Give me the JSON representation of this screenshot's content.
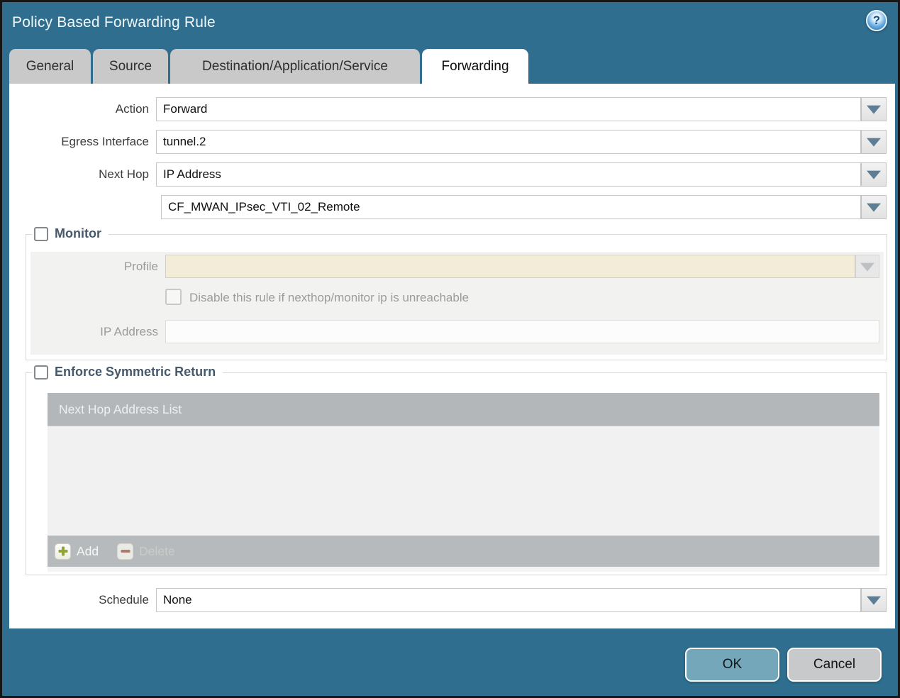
{
  "window": {
    "title": "Policy Based Forwarding Rule"
  },
  "icons": {
    "help": "?"
  },
  "tabs": [
    {
      "label": "General",
      "active": false
    },
    {
      "label": "Source",
      "active": false
    },
    {
      "label": "Destination/Application/Service",
      "active": false
    },
    {
      "label": "Forwarding",
      "active": true
    }
  ],
  "fields": {
    "action": {
      "label": "Action",
      "value": "Forward"
    },
    "egress_interface": {
      "label": "Egress Interface",
      "value": "tunnel.2"
    },
    "next_hop": {
      "label": "Next Hop",
      "value": "IP Address"
    },
    "next_hop_value": {
      "value": "CF_MWAN_IPsec_VTI_02_Remote"
    },
    "schedule": {
      "label": "Schedule",
      "value": "None"
    }
  },
  "monitor": {
    "title": "Monitor",
    "checked": false,
    "profile_label": "Profile",
    "profile_value": "",
    "disable_label": "Disable this rule if nexthop/monitor ip is unreachable",
    "disable_checked": false,
    "ip_label": "IP Address",
    "ip_value": ""
  },
  "symmetric": {
    "title": "Enforce Symmetric Return",
    "checked": false,
    "table_header": "Next Hop Address List",
    "rows": [],
    "add_label": "Add",
    "delete_label": "Delete"
  },
  "actions": {
    "ok": "OK",
    "cancel": "Cancel"
  },
  "colors": {
    "titlebar": "#2f6e8e",
    "ok_button": "#74a7ba",
    "cancel_button": "#c7c9cb",
    "disabled_field": "#f3ecd9",
    "accent_arrow": "#5d7e94"
  }
}
